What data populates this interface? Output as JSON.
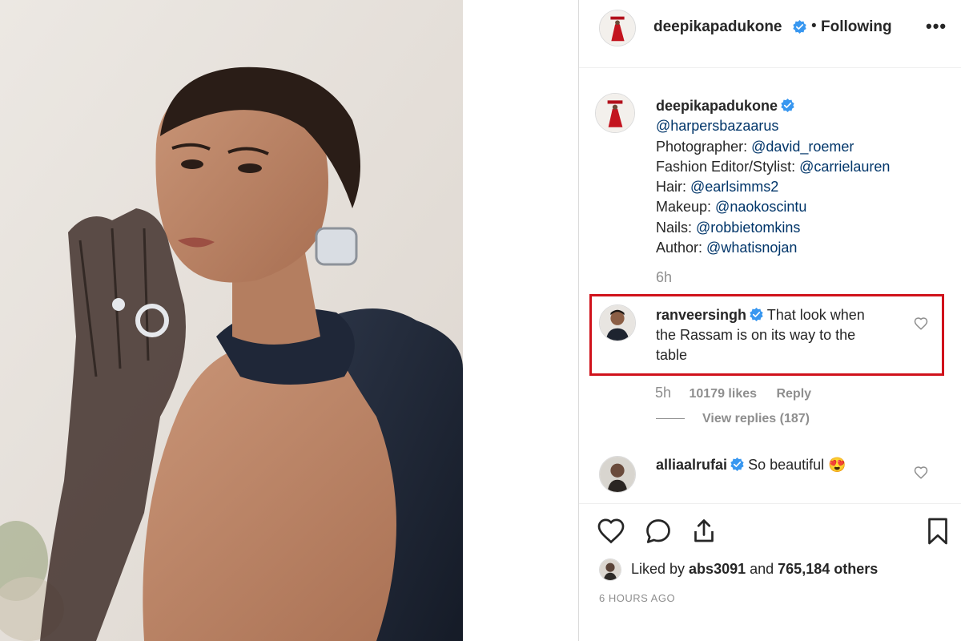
{
  "post": {
    "author": "deepikapadukone",
    "separator": "•",
    "follow_status": "Following",
    "more_label": "•••"
  },
  "caption": {
    "author": "deepikapadukone",
    "lines": [
      {
        "prefix": "",
        "mention": "@harpersbazaarus"
      },
      {
        "prefix": "Photographer: ",
        "mention": "@david_roemer"
      },
      {
        "prefix": "Fashion Editor/Stylist: ",
        "mention": "@carrielauren"
      },
      {
        "prefix": "Hair: ",
        "mention": "@earlsimms2"
      },
      {
        "prefix": "Makeup: ",
        "mention": "@naokoscintu"
      },
      {
        "prefix": "Nails: ",
        "mention": "@robbietomkins"
      },
      {
        "prefix": "Author: ",
        "mention": "@whatisnojan"
      }
    ],
    "time": "6h"
  },
  "comments": [
    {
      "author": "ranveersingh",
      "text_line1": "That look when",
      "text_line2": "the Rassam is on its way to the",
      "text_line3": "table",
      "time": "5h",
      "likes": "10179 likes",
      "reply_label": "Reply",
      "view_replies": "View replies (187)"
    },
    {
      "author": "alliaalrufai",
      "text": "So beautiful",
      "emoji": "😍"
    }
  ],
  "actions": {
    "like_icon": "heart-icon",
    "comment_icon": "comment-bubble-icon",
    "share_icon": "share-icon",
    "save_icon": "bookmark-icon"
  },
  "likes_summary": {
    "prefix": "Liked by ",
    "user": "abs3091",
    "middle": " and ",
    "count": "765,184 others"
  },
  "posted": "6 HOURS AGO",
  "colors": {
    "verified": "#3897f0",
    "mention": "#003569",
    "highlight": "#d0121b",
    "muted": "#8e8e8e"
  }
}
